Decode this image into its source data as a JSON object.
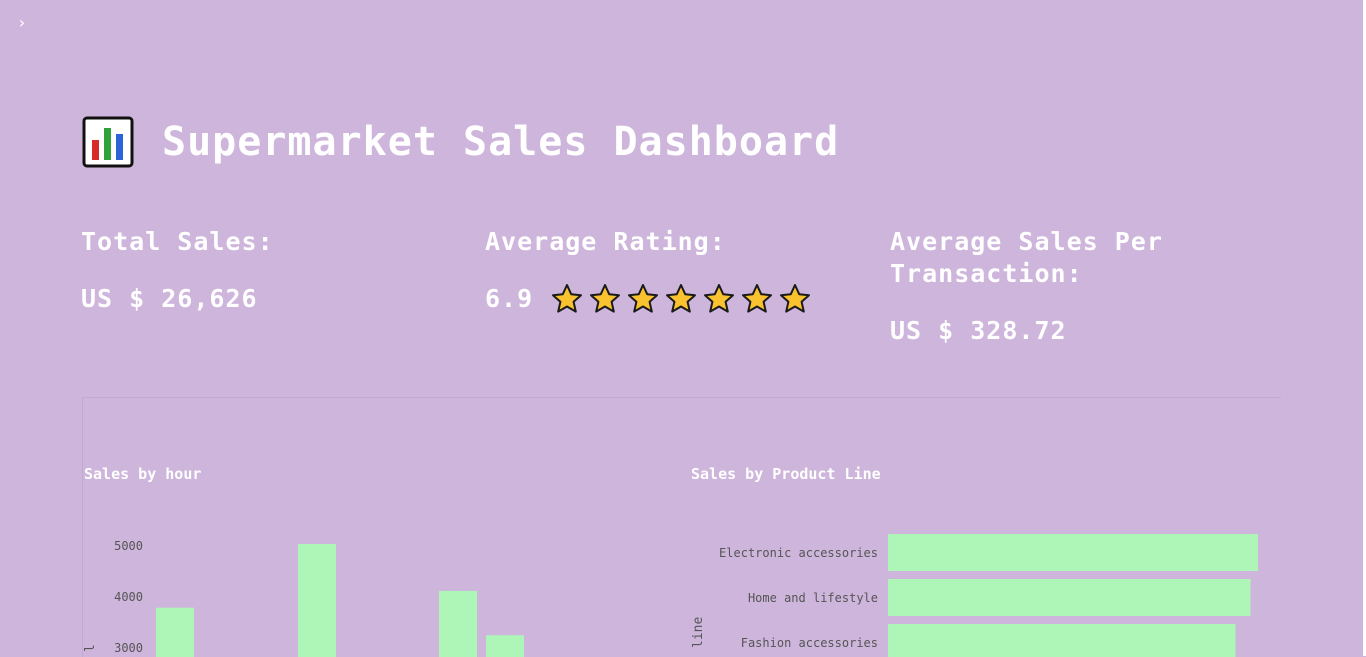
{
  "header": {
    "title": "Supermarket Sales Dashboard",
    "title_icon": "bar-chart-emoji-icon",
    "sidebar_toggle_icon": "chevron-right-icon"
  },
  "metrics": {
    "total_sales": {
      "label": "Total Sales:",
      "value": "US $ 26,626"
    },
    "average_rating": {
      "label": "Average Rating:",
      "value": "6.9",
      "stars": 7
    },
    "average_sales_per_transaction": {
      "label": "Average Sales Per Transaction:",
      "value": "US $ 328.72"
    }
  },
  "colors": {
    "background": "#ceb5dc",
    "bar": "#adf6b7",
    "text": "#ffffff",
    "tick": "#555555",
    "star": "#f9c22e"
  },
  "chart_data": [
    {
      "type": "bar",
      "title": "Sales by hour",
      "orientation": "vertical",
      "ylabel": "l",
      "y_ticks": [
        3000,
        4000,
        5000
      ],
      "ylim": [
        2900,
        5250
      ],
      "values": [
        3790,
        null,
        5040,
        null,
        4120,
        3250
      ]
    },
    {
      "type": "bar",
      "title": "Sales by Product Line",
      "orientation": "horizontal",
      "ylabel": "line",
      "categories": [
        "Electronic accessories",
        "Home and lifestyle",
        "Fashion accessories"
      ],
      "values": [
        4950,
        4850,
        4650
      ],
      "xlim": [
        0,
        5100
      ]
    }
  ]
}
